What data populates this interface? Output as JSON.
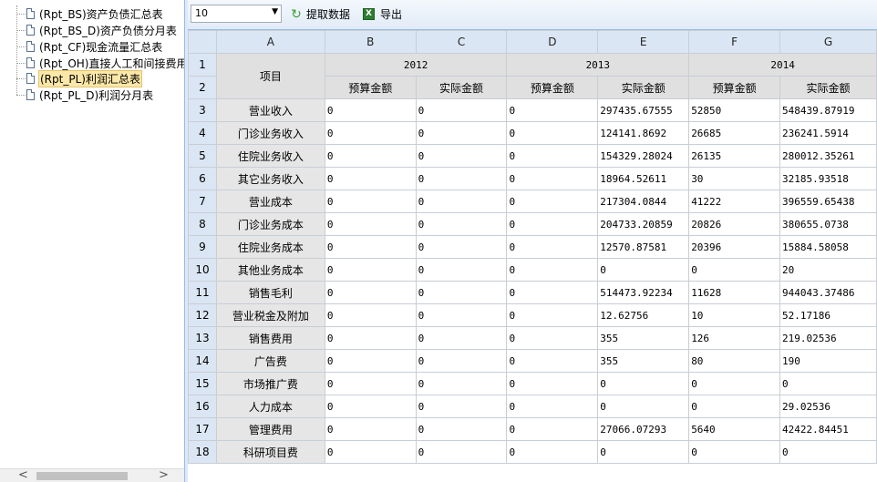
{
  "tree": {
    "items": [
      {
        "label": "(Rpt_BS)资产负债汇总表",
        "selected": false
      },
      {
        "label": "(Rpt_BS_D)资产负债分月表",
        "selected": false
      },
      {
        "label": "(Rpt_CF)现金流量汇总表",
        "selected": false
      },
      {
        "label": "(Rpt_OH)直接人工和间接费用",
        "selected": false
      },
      {
        "label": "(Rpt_PL)利润汇总表",
        "selected": true
      },
      {
        "label": "(Rpt_PL_D)利润分月表",
        "selected": false
      }
    ],
    "scroll_left": "<",
    "scroll_right": ">"
  },
  "toolbar": {
    "page_size_value": "10",
    "fetch_label": "提取数据",
    "export_label": "导出"
  },
  "grid": {
    "columns": [
      "A",
      "B",
      "C",
      "D",
      "E",
      "F",
      "G"
    ],
    "item_header": "项目",
    "years": [
      "2012",
      "2013",
      "2014"
    ],
    "budget_label": "预算金额",
    "actual_label": "实际金额",
    "header_row_numbers": [
      "1",
      "2"
    ],
    "rows": [
      {
        "n": "3",
        "label": "营业收入",
        "values": [
          "0",
          "0",
          "0",
          "297435.67555",
          "52850",
          "548439.87919"
        ]
      },
      {
        "n": "4",
        "label": "门诊业务收入",
        "values": [
          "0",
          "0",
          "0",
          "124141.8692",
          "26685",
          "236241.5914"
        ]
      },
      {
        "n": "5",
        "label": "住院业务收入",
        "values": [
          "0",
          "0",
          "0",
          "154329.28024",
          "26135",
          "280012.35261"
        ]
      },
      {
        "n": "6",
        "label": "其它业务收入",
        "values": [
          "0",
          "0",
          "0",
          "18964.52611",
          "30",
          "32185.93518"
        ]
      },
      {
        "n": "7",
        "label": "营业成本",
        "values": [
          "0",
          "0",
          "0",
          "217304.0844",
          "41222",
          "396559.65438"
        ]
      },
      {
        "n": "8",
        "label": "门诊业务成本",
        "values": [
          "0",
          "0",
          "0",
          "204733.20859",
          "20826",
          "380655.0738"
        ]
      },
      {
        "n": "9",
        "label": "住院业务成本",
        "values": [
          "0",
          "0",
          "0",
          "12570.87581",
          "20396",
          "15884.58058"
        ]
      },
      {
        "n": "10",
        "label": "其他业务成本",
        "values": [
          "0",
          "0",
          "0",
          "0",
          "0",
          "20"
        ]
      },
      {
        "n": "11",
        "label": "销售毛利",
        "values": [
          "0",
          "0",
          "0",
          "514473.92234",
          "11628",
          "944043.37486"
        ]
      },
      {
        "n": "12",
        "label": "营业税金及附加",
        "values": [
          "0",
          "0",
          "0",
          "12.62756",
          "10",
          "52.17186"
        ]
      },
      {
        "n": "13",
        "label": "销售费用",
        "values": [
          "0",
          "0",
          "0",
          "355",
          "126",
          "219.02536"
        ]
      },
      {
        "n": "14",
        "label": "广告费",
        "values": [
          "0",
          "0",
          "0",
          "355",
          "80",
          "190"
        ]
      },
      {
        "n": "15",
        "label": "市场推广费",
        "values": [
          "0",
          "0",
          "0",
          "0",
          "0",
          "0"
        ]
      },
      {
        "n": "16",
        "label": "人力成本",
        "values": [
          "0",
          "0",
          "0",
          "0",
          "0",
          "29.02536"
        ]
      },
      {
        "n": "17",
        "label": "管理费用",
        "values": [
          "0",
          "0",
          "0",
          "27066.07293",
          "5640",
          "42422.84451"
        ]
      },
      {
        "n": "18",
        "label": "科研项目费",
        "values": [
          "0",
          "0",
          "0",
          "0",
          "0",
          "0"
        ]
      }
    ]
  }
}
